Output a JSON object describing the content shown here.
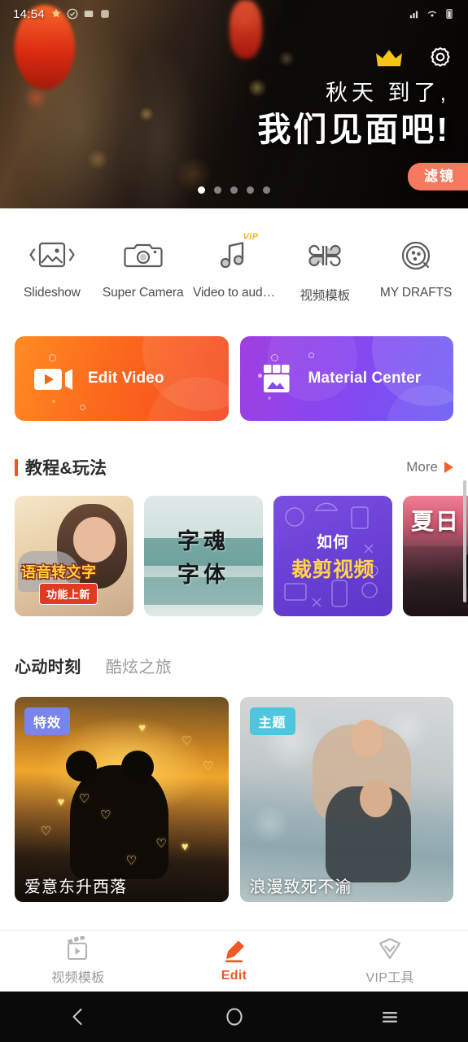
{
  "status_bar": {
    "time": "14:54",
    "left_icons": [
      "notification-icon",
      "check-icon",
      "message-icon",
      "app-icon"
    ],
    "right_icons": [
      "network-icon",
      "wifi-icon",
      "battery-icon"
    ]
  },
  "hero": {
    "crown_icon": "crown-icon",
    "gear_icon": "gear-icon",
    "line1": "秋天 到了,",
    "line2": "我们见面吧!",
    "badge": "滤镜",
    "dots_total": 5,
    "active_dot": 1
  },
  "quick_actions": [
    {
      "label": "Slideshow",
      "icon": "image-slideshow-icon",
      "vip": ""
    },
    {
      "label": "Super Camera",
      "icon": "camera-icon",
      "vip": ""
    },
    {
      "label": "Video to aud…",
      "icon": "music-note-icon",
      "vip": "VIP"
    },
    {
      "label": "视频模板",
      "icon": "grid-petal-icon",
      "vip": ""
    },
    {
      "label": "MY DRAFTS",
      "icon": "film-reel-icon",
      "vip": ""
    }
  ],
  "action_cards": [
    {
      "title": "Edit Video",
      "icon": "video-camera-icon",
      "color": "#fc6a1d"
    },
    {
      "title": "Material Center",
      "icon": "store-front-icon",
      "color": "#8b45ef"
    }
  ],
  "tutorial_section": {
    "title": "教程&玩法",
    "more_label": "More",
    "more_icon": "play-triangle-icon",
    "accent_color": "#ef5723",
    "cards": [
      {
        "title": "语音转文字",
        "badge": "功能上新"
      },
      {
        "title_line1": "字魂",
        "title_line2": "字体"
      },
      {
        "line1": "如何",
        "line2": "裁剪视频"
      },
      {
        "title": "夏日"
      }
    ]
  },
  "content_tabs": [
    {
      "label": "心动时刻",
      "active": true
    },
    {
      "label": "酷炫之旅",
      "active": false
    }
  ],
  "content_cards": [
    {
      "tag": "特效",
      "tag_color": "#7b84ec",
      "title": "爱意东升西落"
    },
    {
      "tag": "主题",
      "tag_color": "#4fc6e0",
      "title": "浪漫致死不渝"
    }
  ],
  "bottom_nav": [
    {
      "label": "视频模板",
      "icon": "clapperboard-icon",
      "active": false
    },
    {
      "label": "Edit",
      "icon": "pencil-edit-icon",
      "active": true
    },
    {
      "label": "VIP工具",
      "icon": "diamond-icon",
      "active": false
    }
  ],
  "system_nav": {
    "back": "back-chevron-icon",
    "home": "home-circle-icon",
    "recents": "recents-menu-icon"
  }
}
